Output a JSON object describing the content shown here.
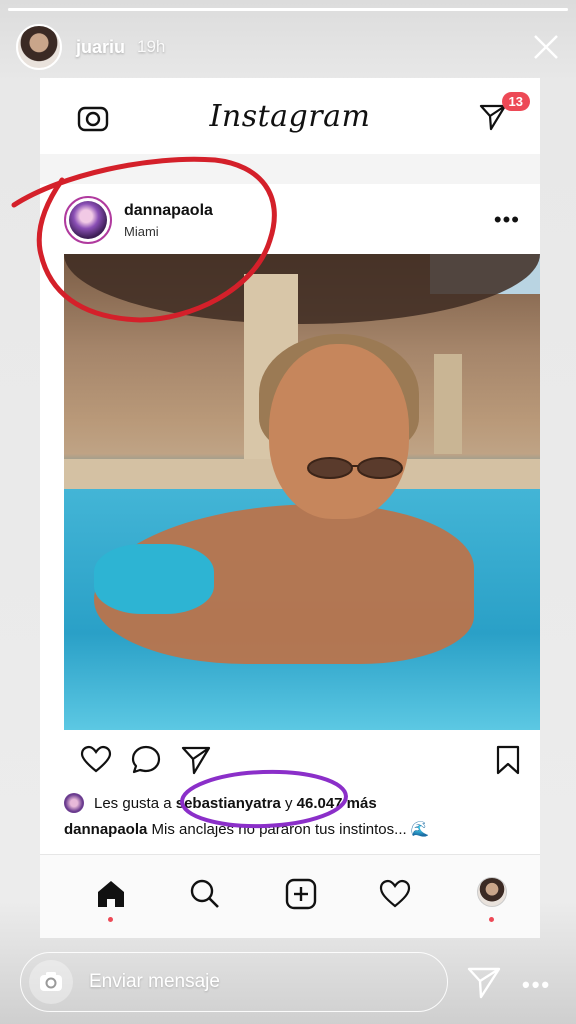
{
  "story": {
    "username": "juariu",
    "time": "19h",
    "progress": 1.0,
    "close_icon": "close-icon"
  },
  "instagram": {
    "logo": "Instagram",
    "direct_badge": "13",
    "accent": "#ed4956"
  },
  "post": {
    "username": "dannapaola",
    "location": "Miami",
    "more": "•••",
    "likes_prefix": "Les gusta a",
    "likes_user": "sebastianyatra",
    "likes_mid": "y",
    "likes_count": "46.047 más",
    "caption_user": "dannapaola",
    "caption_text": "Mis anclajes no pararon tus instintos...",
    "caption_emoji": "🌊"
  },
  "reply": {
    "placeholder": "Enviar mensaje",
    "more": "•••"
  },
  "colors": {
    "annotation_red": "#d4202a",
    "annotation_purple": "#8b2fc9"
  }
}
